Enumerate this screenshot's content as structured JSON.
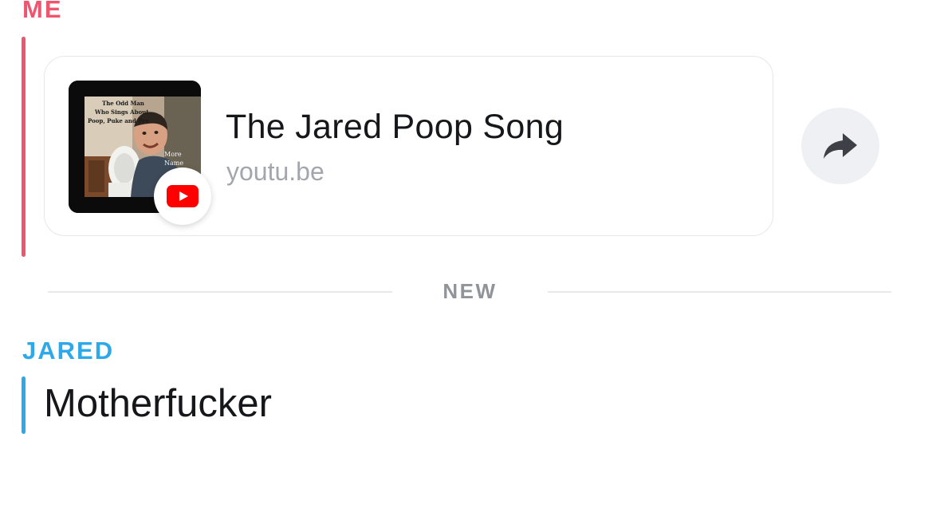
{
  "chat": {
    "me": {
      "sender": "ME",
      "accent_color": "#f0556f",
      "link": {
        "title": "The Jared Poop Song",
        "domain": "youtu.be",
        "thumbnail_text": [
          "The Odd Man",
          "Who Sings About",
          "Poop, Puke and Pee",
          "More",
          "Name"
        ],
        "source_icon": "youtube-icon"
      },
      "share_icon": "share-arrow-icon"
    },
    "divider": {
      "label": "NEW"
    },
    "jared": {
      "sender": "JARED",
      "accent_color": "#2da8e8",
      "message": "Motherfucker"
    }
  }
}
